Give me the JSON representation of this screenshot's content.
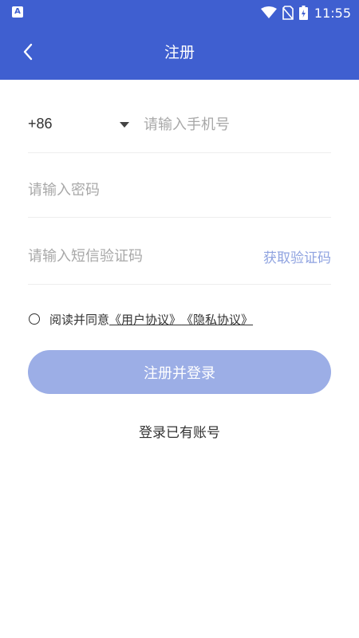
{
  "status_bar": {
    "app_icon_letter": "A",
    "time": "11:55"
  },
  "nav": {
    "title": "注册"
  },
  "form": {
    "country_code": "+86",
    "phone_placeholder": "请输入手机号",
    "password_placeholder": "请输入密码",
    "code_placeholder": "请输入短信验证码",
    "get_code_label": "获取验证码"
  },
  "agreement": {
    "prefix": "阅读并同意",
    "user_agreement": "《用户协议》",
    "privacy_agreement": "《隐私协议》"
  },
  "actions": {
    "submit_label": "注册并登录",
    "login_link": "登录已有账号"
  },
  "colors": {
    "header_bg": "#3f5fd0",
    "button_bg": "#9caee6",
    "link_accent": "#8fa3e0"
  }
}
